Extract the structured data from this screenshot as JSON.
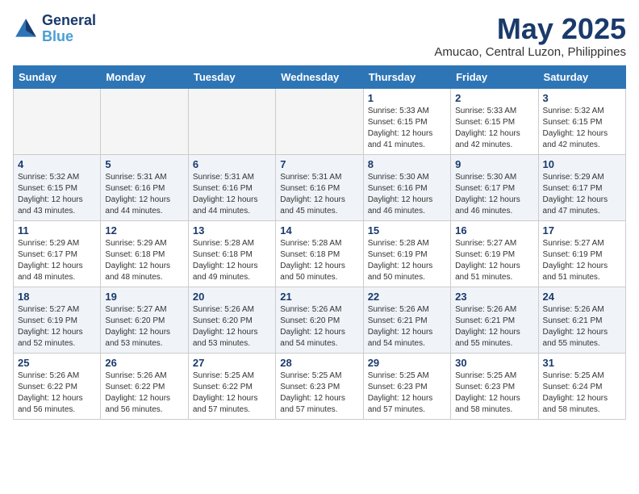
{
  "header": {
    "logo_line1": "General",
    "logo_line2": "Blue",
    "title": "May 2025",
    "subtitle": "Amucao, Central Luzon, Philippines"
  },
  "calendar": {
    "days_of_week": [
      "Sunday",
      "Monday",
      "Tuesday",
      "Wednesday",
      "Thursday",
      "Friday",
      "Saturday"
    ],
    "weeks": [
      [
        {
          "day": "",
          "info": ""
        },
        {
          "day": "",
          "info": ""
        },
        {
          "day": "",
          "info": ""
        },
        {
          "day": "",
          "info": ""
        },
        {
          "day": "1",
          "info": "Sunrise: 5:33 AM\nSunset: 6:15 PM\nDaylight: 12 hours\nand 41 minutes."
        },
        {
          "day": "2",
          "info": "Sunrise: 5:33 AM\nSunset: 6:15 PM\nDaylight: 12 hours\nand 42 minutes."
        },
        {
          "day": "3",
          "info": "Sunrise: 5:32 AM\nSunset: 6:15 PM\nDaylight: 12 hours\nand 42 minutes."
        }
      ],
      [
        {
          "day": "4",
          "info": "Sunrise: 5:32 AM\nSunset: 6:15 PM\nDaylight: 12 hours\nand 43 minutes."
        },
        {
          "day": "5",
          "info": "Sunrise: 5:31 AM\nSunset: 6:16 PM\nDaylight: 12 hours\nand 44 minutes."
        },
        {
          "day": "6",
          "info": "Sunrise: 5:31 AM\nSunset: 6:16 PM\nDaylight: 12 hours\nand 44 minutes."
        },
        {
          "day": "7",
          "info": "Sunrise: 5:31 AM\nSunset: 6:16 PM\nDaylight: 12 hours\nand 45 minutes."
        },
        {
          "day": "8",
          "info": "Sunrise: 5:30 AM\nSunset: 6:16 PM\nDaylight: 12 hours\nand 46 minutes."
        },
        {
          "day": "9",
          "info": "Sunrise: 5:30 AM\nSunset: 6:17 PM\nDaylight: 12 hours\nand 46 minutes."
        },
        {
          "day": "10",
          "info": "Sunrise: 5:29 AM\nSunset: 6:17 PM\nDaylight: 12 hours\nand 47 minutes."
        }
      ],
      [
        {
          "day": "11",
          "info": "Sunrise: 5:29 AM\nSunset: 6:17 PM\nDaylight: 12 hours\nand 48 minutes."
        },
        {
          "day": "12",
          "info": "Sunrise: 5:29 AM\nSunset: 6:18 PM\nDaylight: 12 hours\nand 48 minutes."
        },
        {
          "day": "13",
          "info": "Sunrise: 5:28 AM\nSunset: 6:18 PM\nDaylight: 12 hours\nand 49 minutes."
        },
        {
          "day": "14",
          "info": "Sunrise: 5:28 AM\nSunset: 6:18 PM\nDaylight: 12 hours\nand 50 minutes."
        },
        {
          "day": "15",
          "info": "Sunrise: 5:28 AM\nSunset: 6:19 PM\nDaylight: 12 hours\nand 50 minutes."
        },
        {
          "day": "16",
          "info": "Sunrise: 5:27 AM\nSunset: 6:19 PM\nDaylight: 12 hours\nand 51 minutes."
        },
        {
          "day": "17",
          "info": "Sunrise: 5:27 AM\nSunset: 6:19 PM\nDaylight: 12 hours\nand 51 minutes."
        }
      ],
      [
        {
          "day": "18",
          "info": "Sunrise: 5:27 AM\nSunset: 6:19 PM\nDaylight: 12 hours\nand 52 minutes."
        },
        {
          "day": "19",
          "info": "Sunrise: 5:27 AM\nSunset: 6:20 PM\nDaylight: 12 hours\nand 53 minutes."
        },
        {
          "day": "20",
          "info": "Sunrise: 5:26 AM\nSunset: 6:20 PM\nDaylight: 12 hours\nand 53 minutes."
        },
        {
          "day": "21",
          "info": "Sunrise: 5:26 AM\nSunset: 6:20 PM\nDaylight: 12 hours\nand 54 minutes."
        },
        {
          "day": "22",
          "info": "Sunrise: 5:26 AM\nSunset: 6:21 PM\nDaylight: 12 hours\nand 54 minutes."
        },
        {
          "day": "23",
          "info": "Sunrise: 5:26 AM\nSunset: 6:21 PM\nDaylight: 12 hours\nand 55 minutes."
        },
        {
          "day": "24",
          "info": "Sunrise: 5:26 AM\nSunset: 6:21 PM\nDaylight: 12 hours\nand 55 minutes."
        }
      ],
      [
        {
          "day": "25",
          "info": "Sunrise: 5:26 AM\nSunset: 6:22 PM\nDaylight: 12 hours\nand 56 minutes."
        },
        {
          "day": "26",
          "info": "Sunrise: 5:26 AM\nSunset: 6:22 PM\nDaylight: 12 hours\nand 56 minutes."
        },
        {
          "day": "27",
          "info": "Sunrise: 5:25 AM\nSunset: 6:22 PM\nDaylight: 12 hours\nand 57 minutes."
        },
        {
          "day": "28",
          "info": "Sunrise: 5:25 AM\nSunset: 6:23 PM\nDaylight: 12 hours\nand 57 minutes."
        },
        {
          "day": "29",
          "info": "Sunrise: 5:25 AM\nSunset: 6:23 PM\nDaylight: 12 hours\nand 57 minutes."
        },
        {
          "day": "30",
          "info": "Sunrise: 5:25 AM\nSunset: 6:23 PM\nDaylight: 12 hours\nand 58 minutes."
        },
        {
          "day": "31",
          "info": "Sunrise: 5:25 AM\nSunset: 6:24 PM\nDaylight: 12 hours\nand 58 minutes."
        }
      ]
    ]
  }
}
